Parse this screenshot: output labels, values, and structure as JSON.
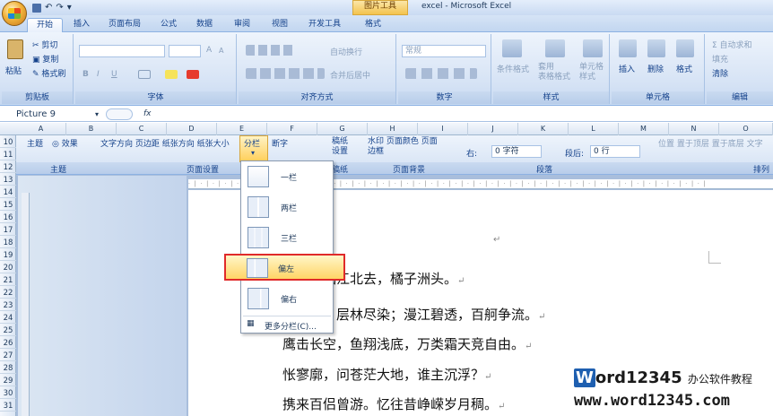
{
  "window": {
    "title": "excel - Microsoft Excel",
    "context_tab": "图片工具"
  },
  "qat": {
    "undo": "↶",
    "redo": "↷"
  },
  "tabs": [
    "开始",
    "插入",
    "页面布局",
    "公式",
    "数据",
    "审阅",
    "视图",
    "开发工具",
    "格式"
  ],
  "ribbon": {
    "clipboard": {
      "paste": "粘贴",
      "cut": "剪切",
      "copy": "复制",
      "format_painter": "格式刷",
      "label": "剪贴板"
    },
    "font": {
      "label": "字体",
      "bold": "B",
      "italic": "I",
      "underline": "U",
      "grow": "A",
      "shrink": "A"
    },
    "alignment": {
      "wrap": "自动换行",
      "merge": "合并后居中",
      "label": "对齐方式"
    },
    "number": {
      "format": "常规",
      "label": "数字"
    },
    "styles": {
      "conditional": "条件格式",
      "table": "套用\n表格格式",
      "cell": "单元格\n样式",
      "label": "样式"
    },
    "cells": {
      "insert": "插入",
      "delete": "删除",
      "format": "格式",
      "label": "单元格"
    },
    "editing": {
      "autosum": "Σ 自动求和",
      "fill": "填充",
      "clear": "清除",
      "label": "编辑"
    }
  },
  "formula_bar": {
    "name_box": "Picture 9",
    "fx": "fx"
  },
  "columns": [
    "A",
    "B",
    "C",
    "D",
    "E",
    "F",
    "G",
    "H",
    "I",
    "J",
    "K",
    "L",
    "M",
    "N",
    "O"
  ],
  "rows": [
    "10",
    "11",
    "12",
    "13",
    "14",
    "15",
    "16",
    "17",
    "18",
    "19",
    "20",
    "21",
    "22",
    "23",
    "24",
    "25",
    "26",
    "27",
    "28",
    "29",
    "30",
    "31"
  ],
  "word_ribbon": {
    "theme_label": "主题",
    "theme": "主题",
    "effects": "效果",
    "page_setup_items": "文字方向 页边距 纸张方向 纸张大小",
    "columns_btn": "分栏",
    "hyphen": "断字",
    "page_setup_label": "页面设置",
    "draft": "稿纸\n设置",
    "draft_label": "稿纸",
    "watermark": "水印 页面颜色 页面\n边框",
    "page_bg_label": "页面背景",
    "indent_right": "右:",
    "indent_right_val": "0 字符",
    "spacing_after": "段后:",
    "spacing_after_val": "0 行",
    "paragraph_label": "段落",
    "arrange": "位置 置于顶层 置于底层 文字",
    "arrange_label": "排列"
  },
  "columns_menu": {
    "items": [
      "一栏",
      "两栏",
      "三栏",
      "偏左",
      "偏右"
    ],
    "selected": "偏左",
    "more": "更多分栏(C)..."
  },
  "document": {
    "lines": [
      "寒秋，湘江北去，橘子洲头。",
      "山红遍，层林尽染；漫江碧透，百舸争流。",
      "鹰击长空，鱼翔浅底，万类霜天竞自由。",
      "怅寥廓，问苍茫大地，谁主沉浮？",
      "携来百侣曾游。忆往昔峥嵘岁月稠。"
    ],
    "para_mark": "↵"
  },
  "watermark": {
    "brand_w": "W",
    "brand": "ord12345",
    "tagline": "办公软件教程",
    "url": "www.word12345.com"
  }
}
